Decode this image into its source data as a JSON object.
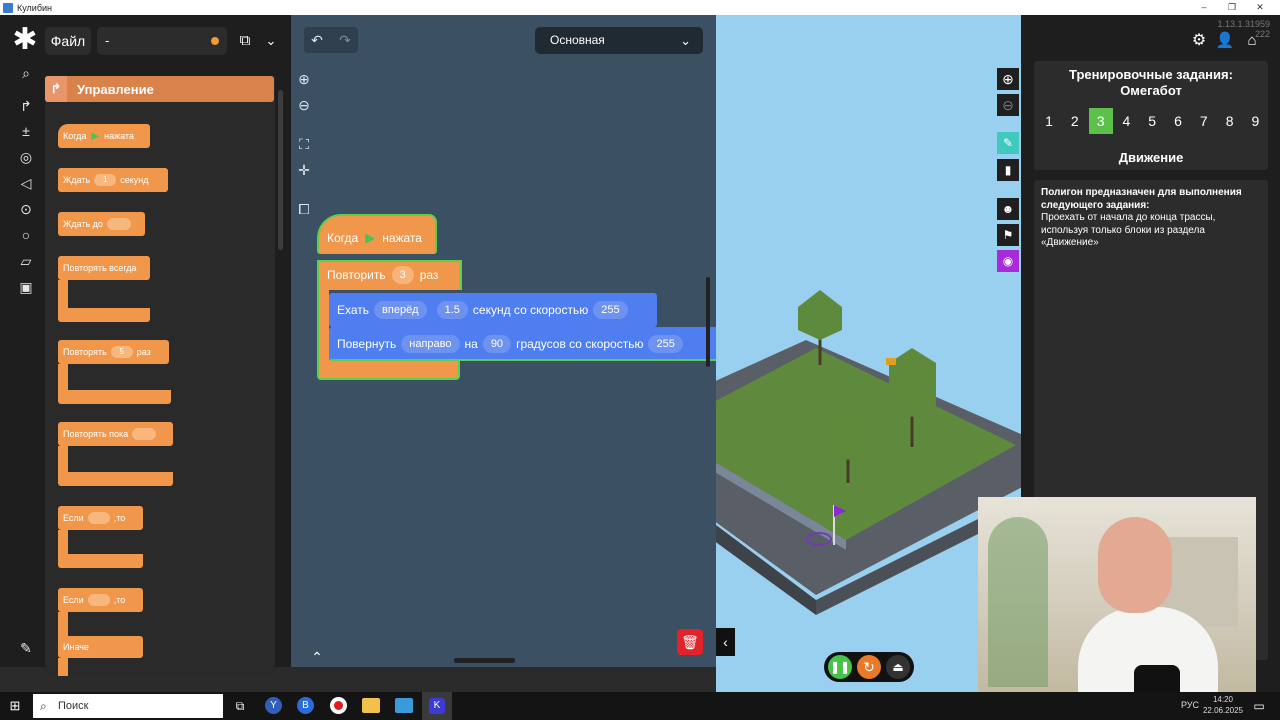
{
  "window": {
    "title": "Кулибин",
    "version": "1.13.1.31959 222"
  },
  "toolbar": {
    "file_label": "Файл",
    "project_name": "-",
    "workspace_select": "Основная"
  },
  "palette": {
    "category": "Управление",
    "blocks": [
      {
        "label": "Когда",
        "suffix": "нажата"
      },
      {
        "label": "Ждать",
        "value": "1",
        "suffix": "секунд"
      },
      {
        "label": "Ждать до"
      },
      {
        "label": "Повторять всегда"
      },
      {
        "label": "Повторять",
        "value": "5",
        "suffix": "раз"
      },
      {
        "label": "Повторять пока"
      },
      {
        "label": "Если",
        "suffix": ",то"
      },
      {
        "label": "Если",
        "suffix": ",то",
        "else_label": "Иначе"
      }
    ]
  },
  "program": {
    "hat": {
      "label": "Когда",
      "suffix": "нажата"
    },
    "repeat": {
      "label": "Повторить",
      "value": "3",
      "suffix": "раз"
    },
    "move": {
      "label": "Ехать",
      "direction": "вперёд",
      "seconds": "1.5",
      "middle": "секунд со скоростью",
      "speed": "255"
    },
    "turn": {
      "label": "Повернуть",
      "direction": "направо",
      "on": "на",
      "degrees": "90",
      "middle": "градусов со скоростью",
      "speed": "255"
    }
  },
  "task": {
    "title": "Тренировочные задания: Омегабот",
    "numbers": [
      "1",
      "2",
      "3",
      "4",
      "5",
      "6",
      "7",
      "8",
      "9"
    ],
    "active_index": 2,
    "section": "Движение",
    "description_bold": "Полигон предназначен для выполнения следующего задания:",
    "description": "Проехать от начала до конца трассы, используя только блоки из раздела «Движение»"
  },
  "taskbar": {
    "search_placeholder": "Поиск",
    "lang": "РУС",
    "time": "14:20",
    "date": "22.06.2025"
  },
  "colors": {
    "control_block": "#f0974b",
    "motion_block": "#4f7ef0",
    "active_task": "#5dc04a",
    "stage_bg": "#99d0ef"
  },
  "icons": [
    "logo-icon",
    "search-icon",
    "puzzle-icon",
    "chevron-down-icon",
    "undo-icon",
    "redo-icon",
    "zoom-in-icon",
    "zoom-out-icon",
    "fit-icon",
    "center-icon",
    "screenshot-icon",
    "settings-icon",
    "user-icon",
    "home-icon",
    "trash-icon",
    "pause-icon",
    "restart-icon",
    "upload-icon",
    "windows-icon"
  ]
}
